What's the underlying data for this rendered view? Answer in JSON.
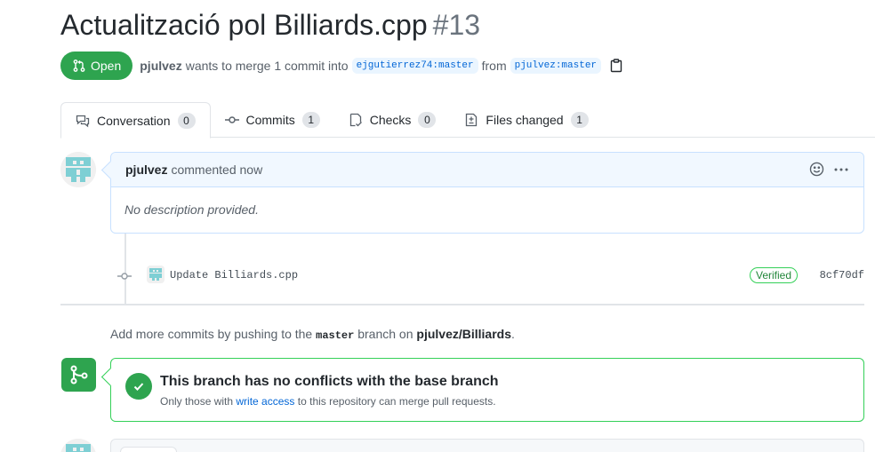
{
  "pr": {
    "title": "Actualització pol Billiards.cpp",
    "number": "#13",
    "state": "Open",
    "author": "pjulvez",
    "merge_text": "wants to merge 1 commit into",
    "base_branch": "ejgutierrez74:master",
    "from_text": "from",
    "head_branch": "pjulvez:master"
  },
  "tabs": [
    {
      "label": "Conversation",
      "count": "0",
      "icon": "comment-discussion-icon"
    },
    {
      "label": "Commits",
      "count": "1",
      "icon": "git-commit-icon"
    },
    {
      "label": "Checks",
      "count": "0",
      "icon": "checklist-icon"
    },
    {
      "label": "Files changed",
      "count": "1",
      "icon": "file-diff-icon"
    }
  ],
  "comment": {
    "author": "pjulvez",
    "time": "commented now",
    "body": "No description provided."
  },
  "commit": {
    "message": "Update Billiards.cpp",
    "badge": "Verified",
    "sha": "8cf70df"
  },
  "hint": {
    "prefix": "Add more commits by pushing to the",
    "branch": "master",
    "middle": "branch on",
    "repo": "pjulvez/Billiards",
    "suffix": "."
  },
  "merge": {
    "title": "This branch has no conflicts with the base branch",
    "sub_prefix": "Only those with",
    "sub_link": "write access",
    "sub_suffix": "to this repository can merge pull requests."
  },
  "colors": {
    "open_green": "#2ea44f",
    "link_blue": "#0366d6",
    "avatar_teal": "#7ecfd4"
  }
}
